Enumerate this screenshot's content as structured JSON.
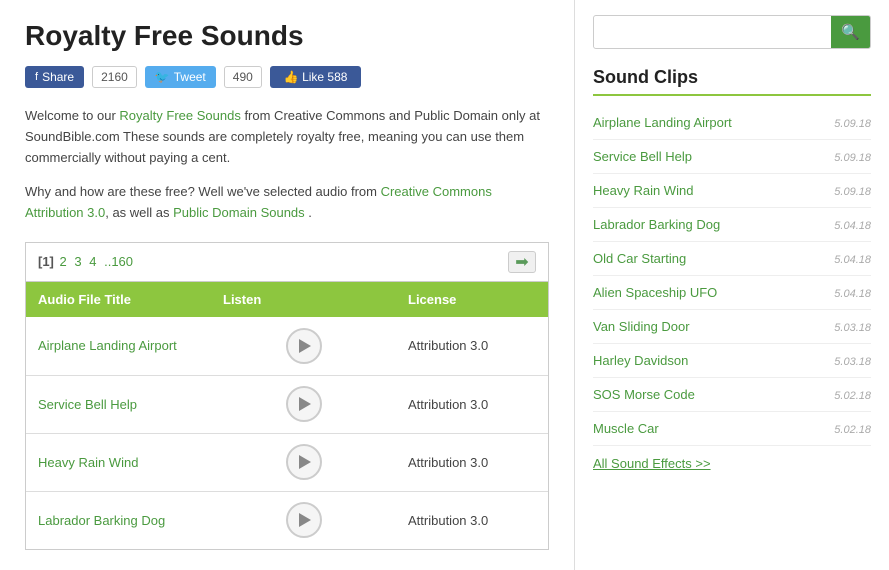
{
  "page": {
    "title": "Royalty Free Sounds",
    "intro": "Welcome to our ",
    "intro_link": "Royalty Free Sounds",
    "intro_rest": " from Creative Commons and Public Domain only at SoundBible.com These sounds are completely royalty free, meaning you can use them commercially without paying a cent.",
    "why_text": "Why and how are these free? Well we've selected audio from ",
    "why_link1": "Creative Commons Attribution 3.0",
    "why_mid": ", as well as ",
    "why_link2": "Public Domain Sounds",
    "why_end": " ."
  },
  "social": {
    "fb_label": "Share",
    "fb_count": "2160",
    "tw_label": "Tweet",
    "tw_count": "490",
    "like_label": "Like 588"
  },
  "table": {
    "nav": {
      "pages_text": "[1] 2 3 4 ..160"
    },
    "headers": {
      "title": "Audio File Title",
      "listen": "Listen",
      "license": "License"
    },
    "rows": [
      {
        "title": "Airplane Landing Airport",
        "license": "Attribution 3.0"
      },
      {
        "title": "Service Bell Help",
        "license": "Attribution 3.0"
      },
      {
        "title": "Heavy Rain Wind",
        "license": "Attribution 3.0"
      },
      {
        "title": "Labrador Barking Dog",
        "license": "Attribution 3.0"
      }
    ]
  },
  "sidebar": {
    "search_placeholder": "",
    "clips_title": "Sound Clips",
    "clips": [
      {
        "name": "Airplane Landing Airport",
        "date": "5.09.18"
      },
      {
        "name": "Service Bell Help",
        "date": "5.09.18"
      },
      {
        "name": "Heavy Rain Wind",
        "date": "5.09.18"
      },
      {
        "name": "Labrador Barking Dog",
        "date": "5.04.18"
      },
      {
        "name": "Old Car Starting",
        "date": "5.04.18"
      },
      {
        "name": "Alien Spaceship UFO",
        "date": "5.04.18"
      },
      {
        "name": "Van Sliding Door",
        "date": "5.03.18"
      },
      {
        "name": "Harley Davidson",
        "date": "5.03.18"
      },
      {
        "name": "SOS Morse Code",
        "date": "5.02.18"
      },
      {
        "name": "Muscle Car",
        "date": "5.02.18"
      }
    ],
    "all_effects_label": "All Sound Effects >>"
  }
}
